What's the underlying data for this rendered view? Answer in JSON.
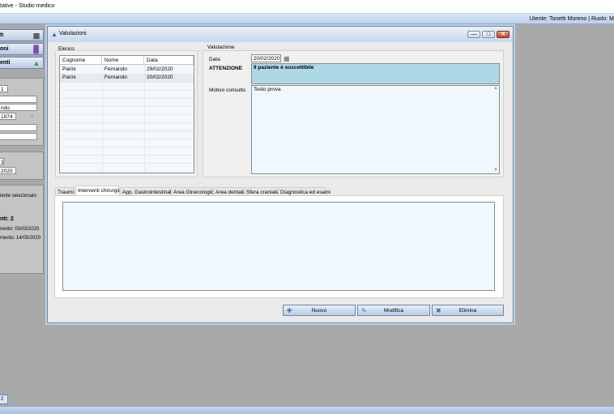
{
  "app": {
    "title": "tative - Studio medico",
    "user_info": "Utente: Tonetti Moreno | Ruolo: M"
  },
  "sidebar": {
    "nav": [
      {
        "label": "ti",
        "icon": "group-icon"
      },
      {
        "label": "oni",
        "icon": "bar-chart-icon"
      },
      {
        "label": "enti",
        "icon": "folder-icon"
      }
    ],
    "patient": {
      "field1": "1",
      "field2": "",
      "field3": "ndo",
      "birth": "1974",
      "gender_symbol": "♂",
      "field5": "",
      "field6": ""
    },
    "second": {
      "field1": "1",
      "date": "2020"
    },
    "info": {
      "selected_text": "iente selezionato",
      "count_text": "nti: 2",
      "date1_text": "nento: 03/03/2020",
      "date2_text": "mento: 14/05/2020"
    },
    "bottom_tab": "2"
  },
  "window": {
    "title": "Valutazioni",
    "controls": {
      "minimize": "—",
      "restore": "□",
      "close": "✕"
    },
    "elenco": {
      "label": "Elenco",
      "columns": [
        "Cognome",
        "Nome",
        "Data"
      ],
      "rows": [
        [
          "Parini",
          "Fernando",
          "29/02/2020"
        ],
        [
          "Parini",
          "Fernando",
          "20/02/2020"
        ]
      ]
    },
    "valutazione": {
      "label": "Valutazione",
      "data_label": "Data",
      "data_value": "20/02/2020",
      "attenzione_label": "ATTENZIONE",
      "attenzione_text": "Il paziente è suscettibile",
      "motivo_label": "Motivo consulto",
      "motivo_value": "Testo prova"
    },
    "tabs": [
      "Traumi",
      "Interventi chirurgici",
      "App. Gastrointestinale",
      "Area Ginecologica",
      "Area dentale",
      "Sfera craniale",
      "Diagnostica ed esami"
    ],
    "active_tab": 1,
    "actions": {
      "nuovo": "Nuovo",
      "modifica": "Modifica",
      "elimina": "Elimina"
    }
  },
  "colors": {
    "accent": "#b9cbe2",
    "attention_bg": "#add8e6",
    "textarea_bg": "#f0f8ff"
  }
}
